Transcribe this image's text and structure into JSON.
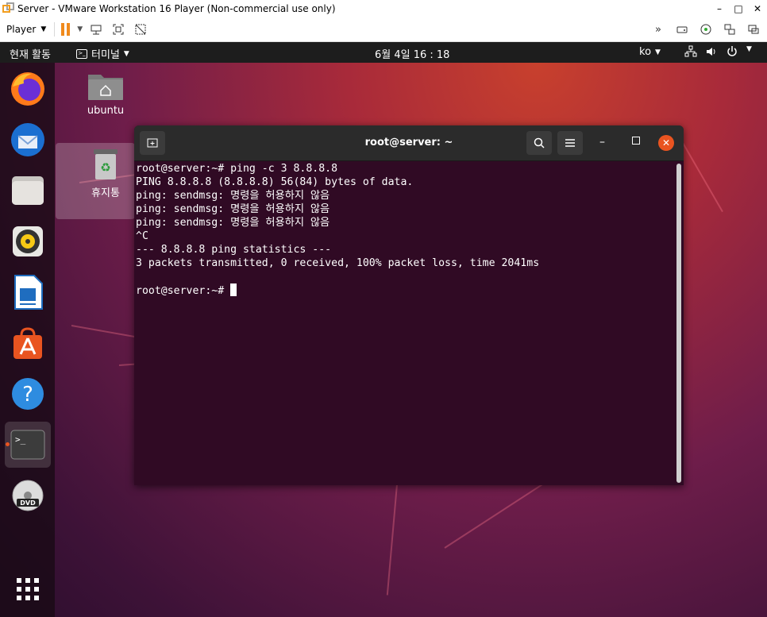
{
  "vmware": {
    "title": "Server - VMware Workstation 16 Player (Non-commercial use only)",
    "player_label": "Player",
    "win_minimize": "–",
    "win_maximize": "□",
    "win_close": "✕"
  },
  "topbar": {
    "activities": "현재 활동",
    "app_menu": "터미널",
    "clock": "6월 4일  16 : 18",
    "lang": "ko"
  },
  "desktop": {
    "home_label": "ubuntu",
    "trash_label": "휴지통"
  },
  "dock": {
    "items": [
      "Firefox",
      "Thunderbird",
      "Files",
      "Rhythmbox",
      "LibreOffice Writer",
      "Ubuntu Software",
      "Help",
      "Terminal",
      "DVD",
      "Show Applications"
    ]
  },
  "terminal": {
    "title": "root@server: ~",
    "lines": [
      "root@server:~# ping -c 3 8.8.8.8",
      "PING 8.8.8.8 (8.8.8.8) 56(84) bytes of data.",
      "ping: sendmsg: 명령을 허용하지 않음",
      "ping: sendmsg: 명령을 허용하지 않음",
      "ping: sendmsg: 명령을 허용하지 않음",
      "^C",
      "--- 8.8.8.8 ping statistics ---",
      "3 packets transmitted, 0 received, 100% packet loss, time 2041ms",
      "",
      "root@server:~# "
    ]
  },
  "colors": {
    "terminal_bg": "#300a24",
    "accent": "#e95420",
    "pause": "#f08a1c"
  }
}
